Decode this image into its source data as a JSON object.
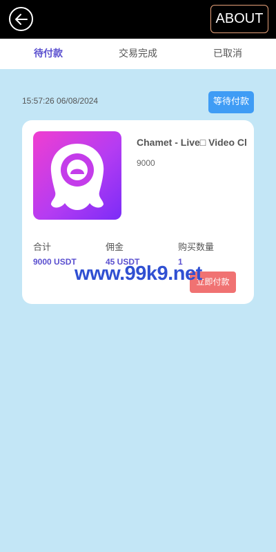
{
  "header": {
    "about_label": "ABOUT"
  },
  "tabs": [
    {
      "label": "待付款"
    },
    {
      "label": "交易完成"
    },
    {
      "label": "已取消"
    }
  ],
  "order": {
    "time": "15:57:26 06/08/2024",
    "status": "等待付款",
    "product_name": "Chamet - Live□ Video Cl",
    "price": "9000",
    "columns": [
      {
        "label": "合计",
        "value": "9000 USDT"
      },
      {
        "label": "佣金",
        "value": "45 USDT"
      },
      {
        "label": "购买数量",
        "value": "1"
      }
    ],
    "pay_label": "立即付款"
  },
  "watermark": "www.99k9.net",
  "colors": {
    "header_bg": "#000000",
    "page_bg": "#c3e6f6",
    "accent": "#5a4fcf",
    "status_badge": "#3f9cf5",
    "pay_button": "#f07272"
  }
}
